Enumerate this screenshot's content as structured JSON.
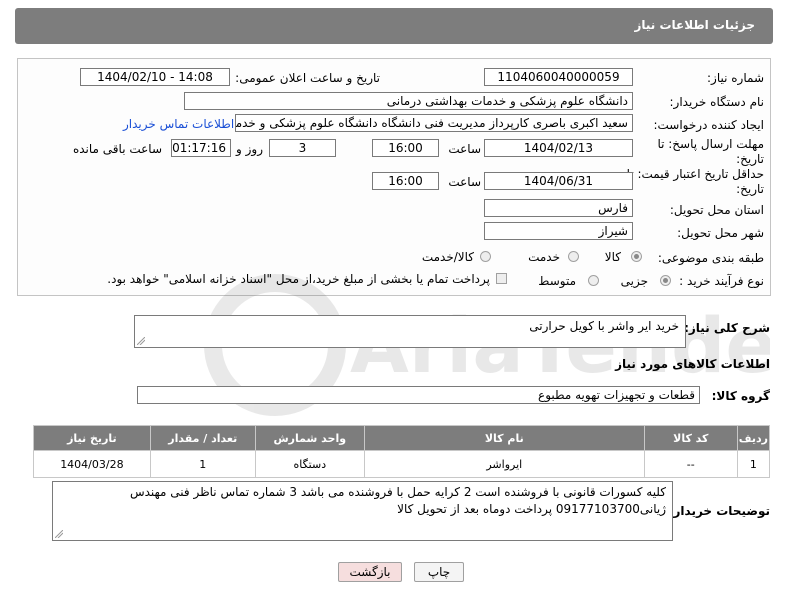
{
  "header": {
    "title": "جزئیات اطلاعات نیاز"
  },
  "form": {
    "need_number_label": "شماره نیاز:",
    "need_number": "1104060040000059",
    "announce_label": "تاریخ و ساعت اعلان عمومی:",
    "announce_value": "1404/02/10 - 14:08",
    "buyer_org_label": "نام دستگاه خریدار:",
    "buyer_org": "دانشگاه علوم پزشکی و خدمات بهداشتی درمانی",
    "creator_label": "ایجاد کننده درخواست:",
    "creator": "سعید اکبری باصری کارپرداز مدیریت فنی دانشگاه دانشگاه علوم پزشکی و خدمات",
    "contact_link": "اطلاعات تماس خریدار",
    "deadline_label": "مهلت ارسال پاسخ: تا تاریخ:",
    "deadline_date": "1404/02/13",
    "time_label": "ساعت",
    "deadline_time": "16:00",
    "days": "3",
    "days_label": "روز و",
    "remaining_time": "01:17:16",
    "remaining_label": "ساعت باقی مانده",
    "validity_label": "حداقل تاریخ اعتبار قیمت: تا تاریخ:",
    "validity_date": "1404/06/31",
    "validity_time": "16:00",
    "province_label": "استان محل تحویل:",
    "province": "فارس",
    "city_label": "شهر محل تحویل:",
    "city": "شیراز",
    "category_label": "طبقه بندی موضوعی:",
    "category_options": [
      "کالا",
      "خدمت",
      "کالا/خدمت"
    ],
    "process_label": "نوع فرآیند خرید :",
    "process_options": [
      "جزیی",
      "متوسط"
    ],
    "payment_note": "پرداخت تمام یا بخشی از مبلغ خرید،از محل \"اسناد خزانه اسلامی\" خواهد بود."
  },
  "description": {
    "label": "شرح کلی نیاز:",
    "value": "خرید ایر واشر با کویل حرارتی"
  },
  "goods": {
    "section_title": "اطلاعات کالاهای مورد نیاز",
    "group_label": "گروه کالا:",
    "group_value": "قطعات و تجهیزات تهویه مطبوع",
    "columns": [
      "ردیف",
      "کد کالا",
      "نام کالا",
      "واحد شمارش",
      "تعداد / مقدار",
      "تاریخ نیاز"
    ],
    "rows": [
      [
        "1",
        "--",
        "ایرواشر",
        "دستگاه",
        "1",
        "1404/03/28"
      ]
    ]
  },
  "buyer_notes": {
    "label": "توضیحات خریدار:",
    "line1": "کلیه کسورات قانونی با فروشنده است 2 کرایه حمل با فروشنده می باشد 3 شماره تماس ناظر فنی مهندس",
    "line2": "ژیانی09177103700 پرداخت دوماه بعد از تحویل کالا"
  },
  "buttons": {
    "print": "چاپ",
    "back": "بازگشت"
  },
  "watermark": {
    "brand": "AriaTender.net"
  },
  "colors": {
    "header_bg": "#7d7d7d",
    "link": "#1a4fd6",
    "back_btn_bg": "#f6dede"
  }
}
